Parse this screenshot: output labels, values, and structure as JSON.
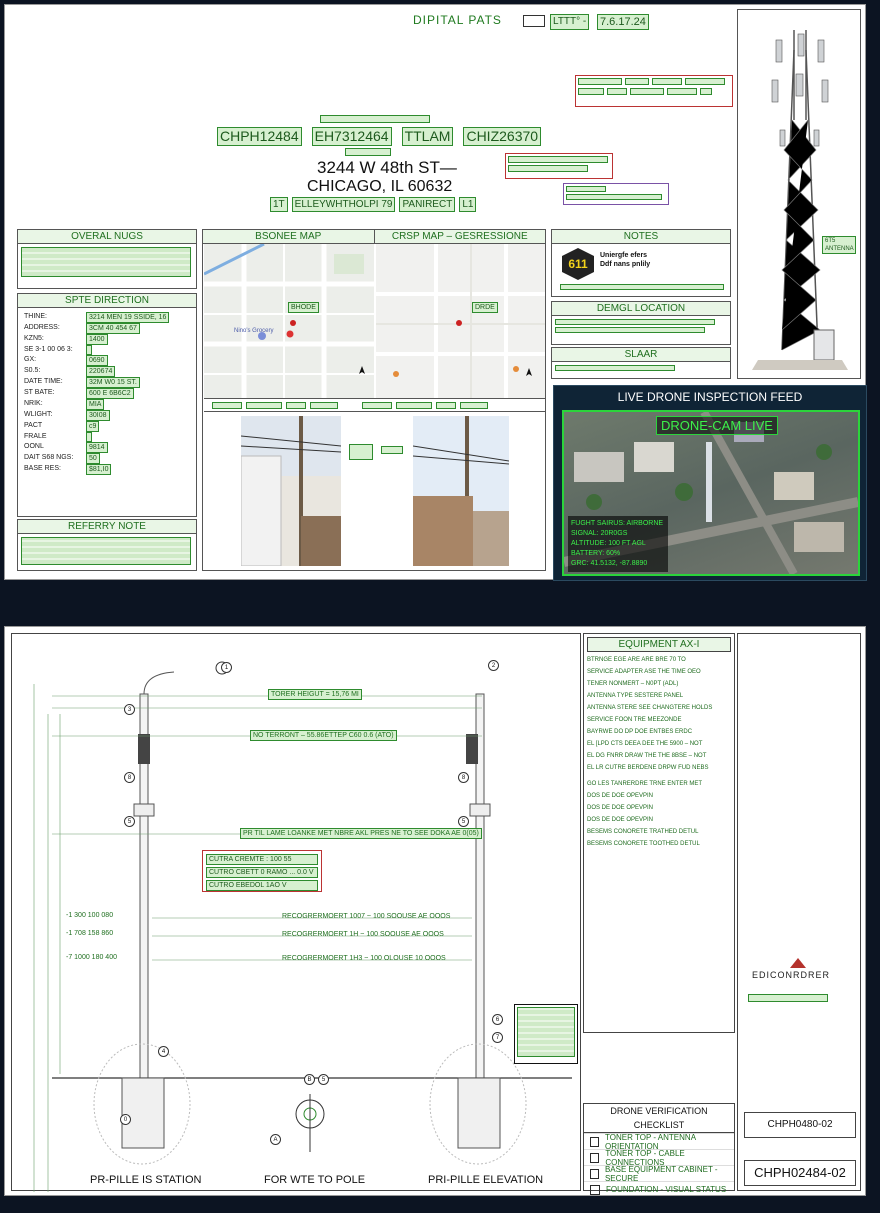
{
  "sheet1": {
    "header": {
      "title": "DIPITAL PATS",
      "ltt_label": "LTTT° -",
      "date": "7.6.17.24"
    },
    "project": {
      "codes": [
        "CHPH12484",
        "EH7312464",
        "TTLAM",
        "CHIZ26370"
      ],
      "street": "3244 W 48th ST—",
      "city": "CHICAGO, IL 60632",
      "footer_bits": [
        "1T",
        "ELLEYWHTHOLPI 79",
        "PANIRECT",
        "L1"
      ]
    },
    "overall_notes": {
      "title": "OVERAL NUGS"
    },
    "site_direction": {
      "title": "SPTE DIRECTION",
      "rows": [
        {
          "k": "THINE:",
          "v": "3214 MEN 19 SSIDE, 16"
        },
        {
          "k": "ADDRESS:",
          "v": "3CM 40 454 67"
        },
        {
          "k": "KZN5:",
          "v": "1400"
        },
        {
          "k": "SE 3-1 00 06 3:",
          "v": ""
        },
        {
          "k": "GX:",
          "v": "0690"
        },
        {
          "k": "S0.5:",
          "v": "220674"
        },
        {
          "k": "DATE TIME:",
          "v": "32M W0 15 ST."
        },
        {
          "k": "ST BATE:",
          "v": "600 E 6B6C2"
        },
        {
          "k": "NRIK:",
          "v": "MIA"
        },
        {
          "k": "WLIGHT:",
          "v": "30I08"
        },
        {
          "k": "PACT",
          "v": "c9"
        },
        {
          "k": "FRALE",
          "v": ""
        },
        {
          "k": "OONL",
          "v": "9814"
        },
        {
          "k": "DAIT S68 NGS:",
          "v": "50"
        },
        {
          "k": "BASE RES:",
          "v": "$81,I0"
        }
      ]
    },
    "referral_note": {
      "title": "REFERRY NOTE"
    },
    "maps": {
      "left_title": "BSONEE MAP",
      "right_title": "CRSP MAP – GESRESSIONE",
      "left_place": "Nino's Grocery",
      "left_marker": "BHODE",
      "right_marker": "DRDE"
    },
    "notes": {
      "title": "NOTES",
      "badge": "611",
      "line1": "Uniergfe efers",
      "line2": "Ddf nans pnlily"
    },
    "demgl_location": {
      "title": "DEMGL LOCATION"
    },
    "slaar": {
      "title": "SLAAR"
    },
    "tower_label": "6T5 ANTENNA",
    "drone": {
      "title": "LIVE DRONE INSPECTION FEED",
      "live_label": "DRONE-CAM LIVE",
      "lines": [
        "FUGHT SAIRUS: AIRBORNE",
        "SIGNAL: 20R0GS",
        "ALTITUDE: 100 FT AGL",
        "BATTERY: 60%",
        "GRC: 41.5132, -87.8890"
      ]
    }
  },
  "sheet2": {
    "tower_height": "TORER HEIGUT = 15,76 MI",
    "dims": [
      "NO TERRONT – 55.86ETTEP C60 0.6 (ATO)",
      "PR TIL LAME LOANKE MET NBRE AKL PRES NE TO SEE DOKA AE 0(05)",
      "RECOGRERMOERT 1007 ~ 100 SOOUSE AE OOOS",
      "RECOGRERMOERT 1H ~ 100 SOOUSE AE OOOS",
      "RECOGRERMOERT 1H3 ~ 100 OLOUSE 10 OOOS"
    ],
    "clearance": [
      "CUTRA CREMTE : 100 55",
      "CUTRO CBETT 0 RAMO ... 0.0 V",
      "CUTRO EBEDOL 1AO V"
    ],
    "left_marks": [
      "-1 300 100 080",
      "-1 708 158 860",
      "-7 1000 180 400"
    ],
    "station_label": "PR-PILLE IS STATION",
    "wire_label": "FOR WTE TO POLE",
    "elevation_label": "PRI-PILLE ELEVATION",
    "equipment": {
      "title": "EQUIPMENT AX-I",
      "items": [
        "BTRNGE EGE ARE ARE BRE 70 TO",
        "SERVICE ADAPTER ASE THE TIME OEO",
        "TENER NONMERT – N0PT (ADL)",
        "ANTENNA TYPE SESTERE PANEL",
        "ANTENNA STERE SEE CHANGTERE HOLDS",
        "SERVICE FOON TRE MEEZONDE",
        "BAYRWE DO DP DOE ENTBES ERDC",
        "EL [LPD CTS DEEA DEE THE 5900 – NOT",
        "EL DG FNRR DRAW THE THE 8BSE – NOT",
        "EL LR CUTRE BERDENE DRPW FUD NEBS"
      ],
      "legend": [
        "GO LES TANRERDRE TRNE ENTER MET",
        "DOS DE DOE OPEVPIN",
        "DOS DE DOE OPEVPIN",
        "DOS DE DOE OPEVPIN",
        "BESEMS CONORETE TRATHED DETUL",
        "BESEMS CONORETE TOOTHED DETUL"
      ]
    },
    "checklist": {
      "title": "DRONE VERIFICATION CHECKLIST",
      "items": [
        "TONER TOP - ANTENNA ORIENTATION",
        "TONER TOP - CABLE CONNECTIONS",
        "BASE EQUIPMENT CABINET - SECURE",
        "FOUNDATION - VISUAL STATUS"
      ]
    },
    "titleblock": {
      "company": "EDICONRDRER",
      "sheet_small": "CHPH0480-02",
      "sheet_big": "CHPH02484-02"
    }
  }
}
